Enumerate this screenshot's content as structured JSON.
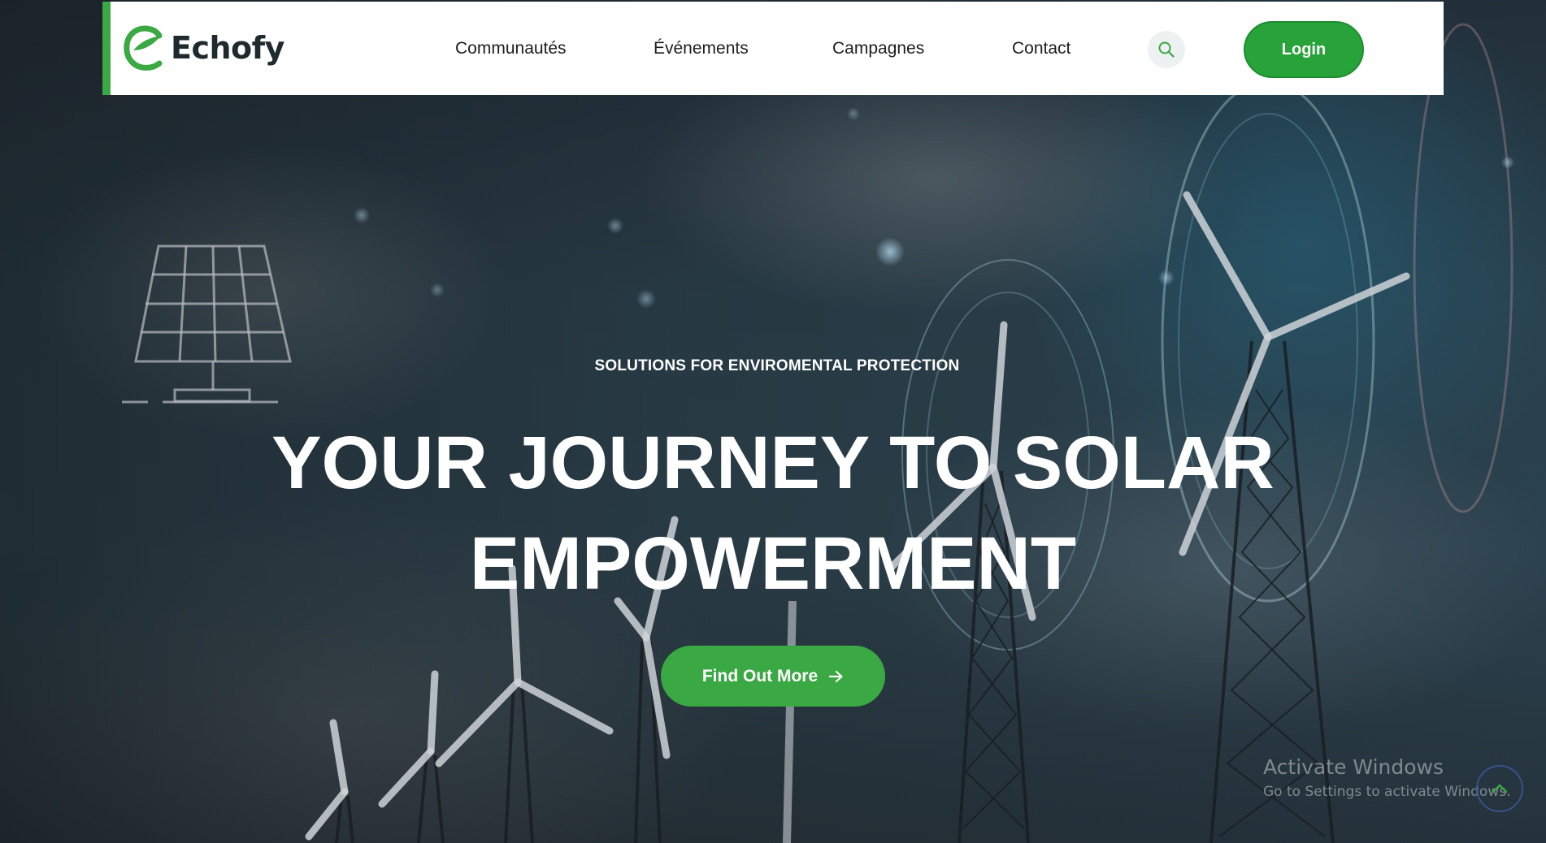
{
  "brand": {
    "name": "Echofy",
    "accent": "#3aa843"
  },
  "nav": {
    "items": [
      {
        "label": "Communautés"
      },
      {
        "label": "Événements"
      },
      {
        "label": "Campagnes"
      },
      {
        "label": "Contact"
      }
    ],
    "search_icon": "search-icon",
    "login_label": "Login"
  },
  "hero": {
    "subtitle": "SOLUTIONS FOR ENVIROMENTAL PROTECTION",
    "headline_line1": "YOUR JOURNEY TO SOLAR",
    "headline_line2": "EMPOWERMENT",
    "cta_label": "Find Out More",
    "cta_icon": "arrow-right-icon"
  },
  "system": {
    "watermark_title": "Activate Windows",
    "watermark_sub": "Go to Settings to activate Windows.",
    "scroll_icon": "chevron-up-icon"
  }
}
